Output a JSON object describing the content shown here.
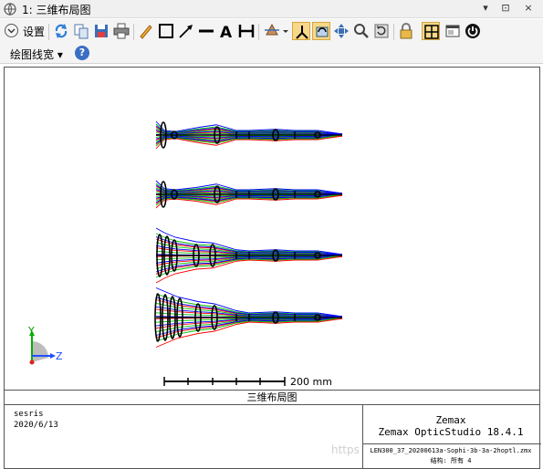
{
  "window": {
    "title": "1: 三维布局图",
    "controls": [
      "▾",
      "⊡",
      "×"
    ]
  },
  "toolbar": {
    "settings_label": "设置",
    "icons": [
      "refresh-icon",
      "copy-icon",
      "save-icon",
      "print-icon",
      "pencil-icon",
      "rectangle-icon",
      "arrow-icon",
      "line-icon",
      "text-icon",
      "dimension-icon",
      "rotate-icon",
      "axis-icon",
      "rotate-view-icon",
      "pan-icon",
      "zoom-icon",
      "reset-icon",
      "lock-icon",
      "fit-icon",
      "window-icon",
      "power-icon"
    ],
    "line_width_label": "绘图线宽 ▾",
    "help_label": "?"
  },
  "plot": {
    "axes": {
      "y": "Y",
      "z": "Z"
    },
    "scale_label": "200 mm",
    "configurations": 4,
    "colors": {
      "blue": "#0000ff",
      "green": "#00c000",
      "red": "#ff0000",
      "lens": "#000000"
    }
  },
  "footer": {
    "caption": "三维布局图",
    "left_line1": "sesris",
    "left_line2": "2020/6/13",
    "right_line1": "Zemax",
    "right_line2": "Zemax OpticStudio 18.4.1",
    "file_line": "LEN300_37_20200613a-Sophi-3b-3a-2hoptl.zmx",
    "config_line": "结构: 所有 4",
    "watermark": "https"
  }
}
